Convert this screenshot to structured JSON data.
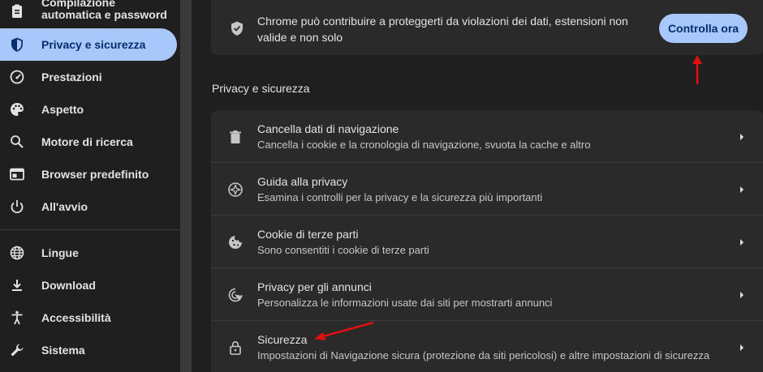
{
  "sidebar": {
    "items": [
      {
        "label": "Compilazione automatica e password",
        "icon": "clipboard-icon"
      },
      {
        "label": "Privacy e sicurezza",
        "icon": "shield-icon",
        "active": true
      },
      {
        "label": "Prestazioni",
        "icon": "speedometer-icon"
      },
      {
        "label": "Aspetto",
        "icon": "palette-icon"
      },
      {
        "label": "Motore di ricerca",
        "icon": "search-icon"
      },
      {
        "label": "Browser predefinito",
        "icon": "browser-window-icon"
      },
      {
        "label": "All'avvio",
        "icon": "power-icon"
      },
      {
        "label": "Lingue",
        "icon": "globe-icon"
      },
      {
        "label": "Download",
        "icon": "download-icon"
      },
      {
        "label": "Accessibilità",
        "icon": "accessibility-icon"
      },
      {
        "label": "Sistema",
        "icon": "wrench-icon"
      }
    ]
  },
  "safety_check": {
    "text": "Chrome può contribuire a proteggerti da violazioni dei dati, estensioni non valide e non solo",
    "button_label": "Controlla ora",
    "icon": "shield-check-icon"
  },
  "section": {
    "title": "Privacy e sicurezza",
    "rows": [
      {
        "title": "Cancella dati di navigazione",
        "subtitle": "Cancella i cookie e la cronologia di navigazione, svuota la cache e altro",
        "icon": "trash-icon"
      },
      {
        "title": "Guida alla privacy",
        "subtitle": "Esamina i controlli per la privacy e la sicurezza più importanti",
        "icon": "compass-icon"
      },
      {
        "title": "Cookie di terze parti",
        "subtitle": "Sono consentiti i cookie di terze parti",
        "icon": "cookie-icon"
      },
      {
        "title": "Privacy per gli annunci",
        "subtitle": "Personalizza le informazioni usate dai siti per mostrarti annunci",
        "icon": "ad-target-icon"
      },
      {
        "title": "Sicurezza",
        "subtitle": "Impostazioni di Navigazione sicura (protezione da siti pericolosi) e altre impostazioni di sicurezza",
        "icon": "lock-icon"
      }
    ]
  },
  "colors": {
    "accent": "#a8c7fa",
    "annotation_arrow": "#e01010"
  }
}
